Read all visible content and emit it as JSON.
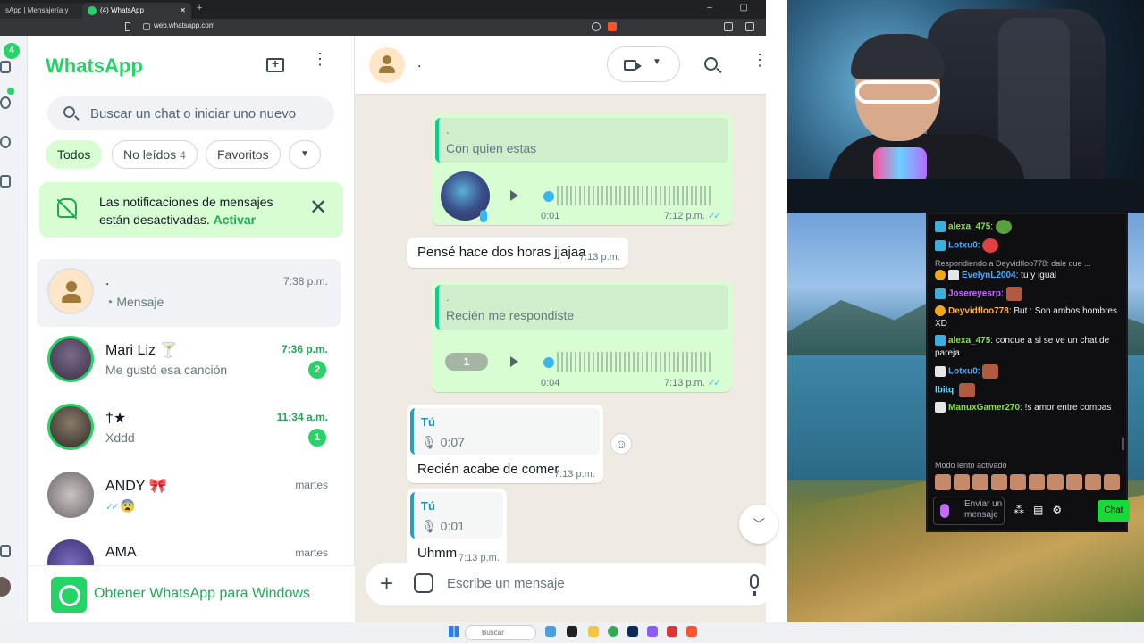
{
  "browser": {
    "tab1_title": "sApp | Mensajería y llamadas gr...",
    "tab2_title": "(4) WhatsApp",
    "url": "web.whatsapp.com"
  },
  "rail": {
    "unread_count": "4"
  },
  "sidebar": {
    "title": "WhatsApp",
    "search_placeholder": "Buscar un chat o iniciar uno nuevo",
    "filters": [
      {
        "label": "Todos"
      },
      {
        "label": "No leídos",
        "count": "4"
      },
      {
        "label": "Favoritos"
      }
    ],
    "notification": {
      "text": "Las notificaciones de mensajes están desactivadas.",
      "action": "Activar"
    },
    "chats": [
      {
        "name": ".",
        "time": "7:38 p.m.",
        "preview": "Mensaje",
        "unread": ""
      },
      {
        "name": "Mari Liz 🍸",
        "time": "7:36 p.m.",
        "preview": "Me gustó esa canción",
        "unread": "2"
      },
      {
        "name": "†★",
        "time": "11:34 a.m.",
        "preview": "Xddd",
        "unread": "1"
      },
      {
        "name": "ANDY 🎀",
        "time": "martes",
        "preview": "😨",
        "unread": ""
      },
      {
        "name": "AMA",
        "time": "martes",
        "preview": "",
        "unread": ""
      }
    ],
    "get_app": "Obtener WhatsApp para Windows"
  },
  "conversation": {
    "contact_name": ".",
    "messages": [
      {
        "quote_author": ".",
        "quote_text": "Con quien estas",
        "duration": "0:01",
        "time": "7:12 p.m."
      },
      {
        "text": "Pensé hace dos horas jjajaa",
        "time": "7:13 p.m."
      },
      {
        "quote_author": ".",
        "quote_text": "Recién me respondiste",
        "speed": "1",
        "duration": "0:04",
        "time": "7:13 p.m."
      },
      {
        "quote_author": "Tú",
        "quote_voice": "0:07",
        "text": "Recién acabe de comer",
        "time": "7:13 p.m."
      },
      {
        "quote_author": "Tú",
        "quote_voice": "0:01",
        "text": "Uhmm",
        "time": "7:13 p.m."
      }
    ],
    "composer_placeholder": "Escribe un mensaje"
  },
  "stream_chat": {
    "messages": [
      {
        "user": "alexa_475",
        "text": ""
      },
      {
        "user": "Lotxu0",
        "text": ""
      },
      {
        "reply": "Respondiendo a Deyvidfloo778: dale que ...",
        "user": "EvelynL2004",
        "text": "tu y igual"
      },
      {
        "user": "Josereyesrp",
        "text": ""
      },
      {
        "user": "Deyvidfloo778",
        "text": "But : Son ambos hombres XD"
      },
      {
        "user": "alexa_475",
        "text": "conque a si se ve un chat de pareja"
      },
      {
        "user": "Lotxu0",
        "text": ""
      },
      {
        "user": "lbitq",
        "text": ""
      },
      {
        "user": "ManuxGamer270",
        "text": "!s amor entre compas"
      }
    ],
    "slow_mode": "Modo lento activado",
    "input_placeholder": "Enviar un mensaje",
    "chat_button": "Chat"
  },
  "taskbar": {
    "search": "Buscar"
  }
}
